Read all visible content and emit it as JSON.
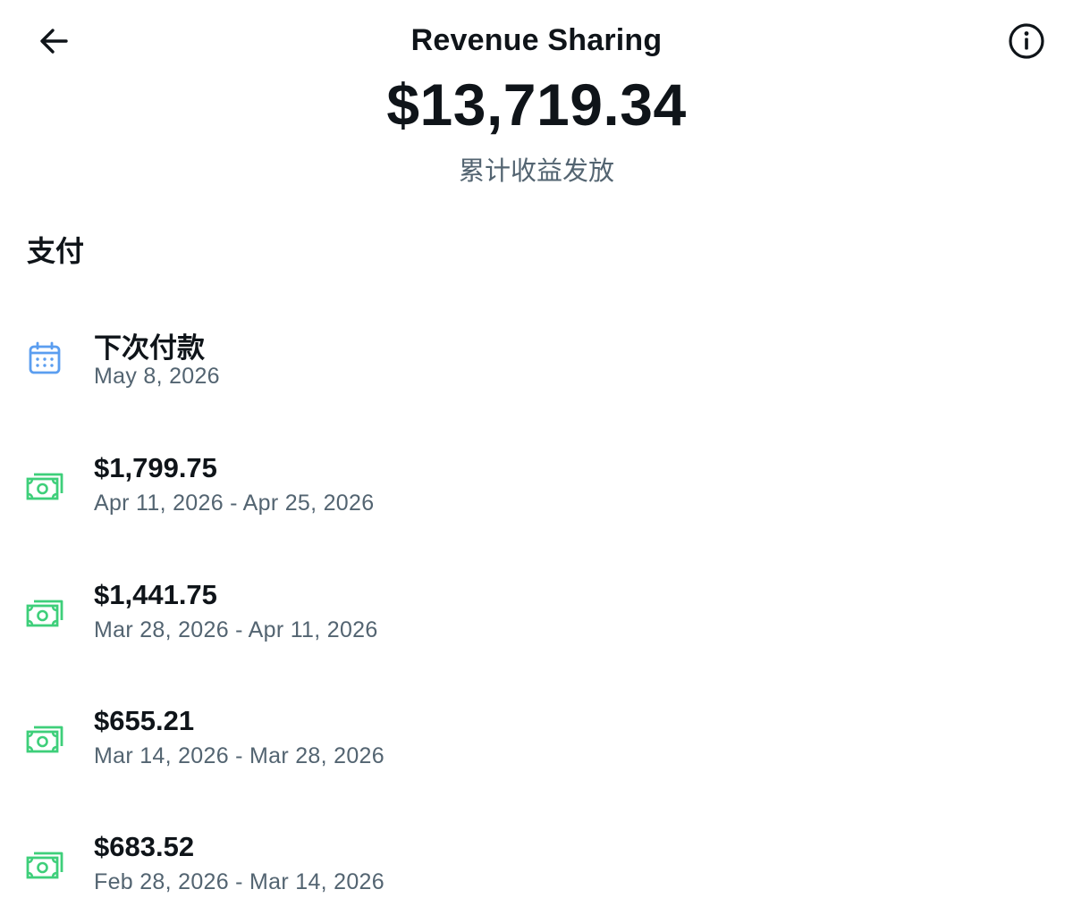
{
  "header": {
    "title": "Revenue Sharing",
    "back_icon": "arrow-left-icon",
    "info_icon": "info-circle-icon"
  },
  "summary": {
    "total": "$13,719.34",
    "caption": "累计收益发放"
  },
  "payouts_section": {
    "title": "支付",
    "next_payment": {
      "label": "下次付款",
      "date": "May 8, 2026",
      "icon": "calendar-icon"
    },
    "items": [
      {
        "amount": "$1,799.75",
        "period": "Apr 11, 2026 - Apr 25, 2026",
        "icon": "money-icon"
      },
      {
        "amount": "$1,441.75",
        "period": "Mar 28, 2026 - Apr 11, 2026",
        "icon": "money-icon"
      },
      {
        "amount": "$655.21",
        "period": "Mar 14, 2026 - Mar 28, 2026",
        "icon": "money-icon"
      },
      {
        "amount": "$683.52",
        "period": "Feb 28, 2026 - Mar 14, 2026",
        "icon": "money-icon"
      }
    ]
  },
  "colors": {
    "text_primary": "#0f1419",
    "text_secondary": "#536471",
    "calendar_icon": "#5b9ef0",
    "money_icon": "#3ecf7a"
  }
}
